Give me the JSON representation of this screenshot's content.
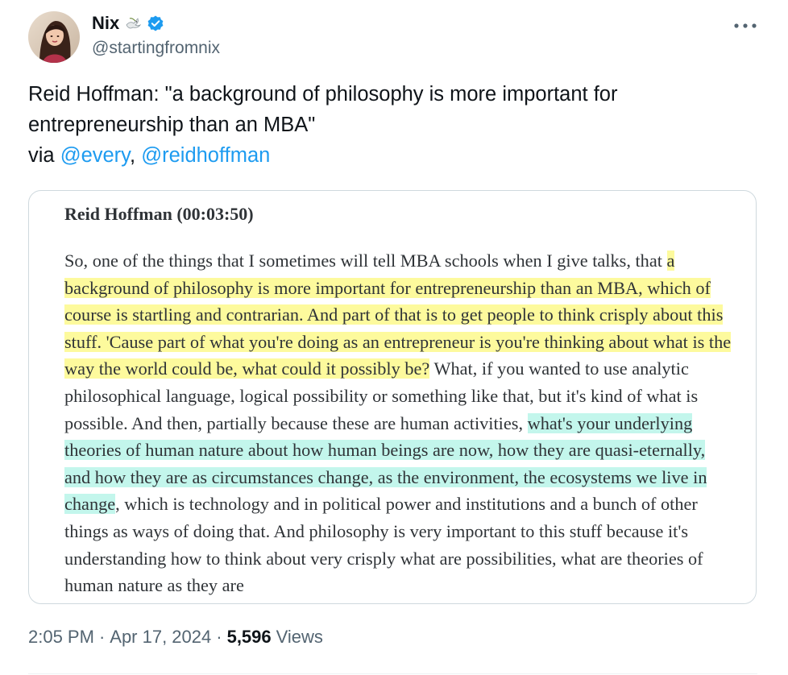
{
  "author": {
    "display_name": "Nix",
    "handle": "@startingfromnix",
    "avatar_icon": "avatar-portrait",
    "badge_icons": [
      "dove-emoji-icon",
      "verified-icon"
    ]
  },
  "more_label": "•••",
  "tweet": {
    "line1": "Reid Hoffman: \"a background of philosophy is more important for entrepreneurship than an MBA\"",
    "via_prefix": "via ",
    "mention1": "@every",
    "separator": ", ",
    "mention2": "@reidhoffman"
  },
  "quote": {
    "speaker": "Reid Hoffman (00:03:50)",
    "seg1": "So, one of the things that I sometimes will tell MBA schools when I give talks, that ",
    "seg2_highlight_yellow": "a background of philosophy is more important for entrepreneurship than an MBA, which of course is startling and contrarian. And part of that is to get people to think crisply about this stuff. 'Cause part of what you're doing as an entrepreneur is you're thinking about what is the way the world could be, what could it possibly be?",
    "seg3": " What, if you wanted to use analytic philosophical language, logical possibility or something like that, but it's kind of what is possible. And then, partially because these are human activities, ",
    "seg4_highlight_teal": "what's your underlying theories of human nature about how human beings are now, how they are quasi-eternally, and how they are as circumstances change, as the environment, the ecosystems we live in change",
    "seg5": ", which is technology and in political power and institutions and a bunch of other things as ways of doing that. And philosophy is very important to this stuff because it's understanding how to think about very crisply what are possibilities, what are theories of human nature as they are"
  },
  "meta": {
    "time": "2:05 PM",
    "dot1": "·",
    "date": "Apr 17, 2024",
    "dot2": "·",
    "views_count": "5,596",
    "views_label": "Views"
  },
  "colors": {
    "accent": "#1d9bf0",
    "highlight_yellow": "#fdfa9d",
    "highlight_teal": "#c3f6ec",
    "secondary_text": "#536471"
  }
}
